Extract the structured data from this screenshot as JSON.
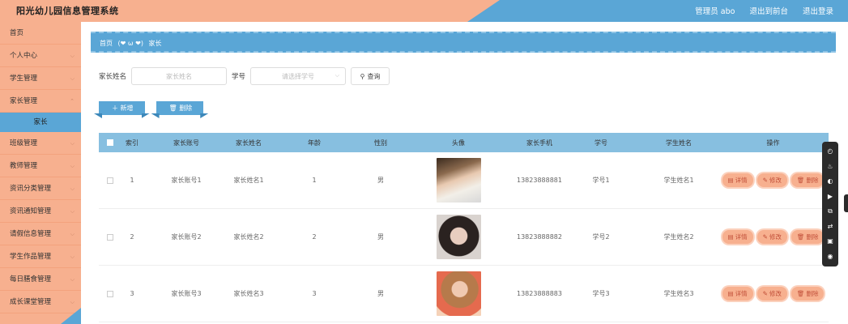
{
  "header": {
    "title": "阳光幼儿园信息管理系统",
    "nav": [
      "管理员 abo",
      "退出到前台",
      "退出登录"
    ]
  },
  "sidebar": {
    "items": [
      {
        "label": "首页",
        "chev": false
      },
      {
        "label": "个人中心",
        "chev": true
      },
      {
        "label": "学生管理",
        "chev": true
      },
      {
        "label": "家长管理",
        "chev": true
      },
      {
        "label": "班级管理",
        "chev": true
      },
      {
        "label": "教师管理",
        "chev": true
      },
      {
        "label": "资讯分类管理",
        "chev": true
      },
      {
        "label": "资讯通知管理",
        "chev": true
      },
      {
        "label": "请假信息管理",
        "chev": true
      },
      {
        "label": "学生作品管理",
        "chev": true
      },
      {
        "label": "每日膳食管理",
        "chev": true
      },
      {
        "label": "成长课堂管理",
        "chev": true
      }
    ],
    "sub_active": "家长"
  },
  "breadcrumb": {
    "home": "首页",
    "separator": "(❤ ω ❤)",
    "current": "家长"
  },
  "search": {
    "name_label": "家长姓名",
    "name_placeholder": "家长姓名",
    "sno_label": "学号",
    "sno_placeholder": "请选择学号",
    "query_label": "查询"
  },
  "actions": {
    "add_label": "新增",
    "delete_label": "删除"
  },
  "table": {
    "headers": [
      "索引",
      "家长账号",
      "家长姓名",
      "年龄",
      "性别",
      "头像",
      "家长手机",
      "学号",
      "学生姓名",
      "操作"
    ],
    "rows": [
      {
        "idx": "1",
        "account": "家长账号1",
        "name": "家长姓名1",
        "age": "1",
        "sex": "男",
        "phone": "13823888881",
        "sno": "学号1",
        "sname": "学生姓名1"
      },
      {
        "idx": "2",
        "account": "家长账号2",
        "name": "家长姓名2",
        "age": "2",
        "sex": "男",
        "phone": "13823888882",
        "sno": "学号2",
        "sname": "学生姓名2"
      },
      {
        "idx": "3",
        "account": "家长账号3",
        "name": "家长姓名3",
        "age": "3",
        "sex": "男",
        "phone": "13823888883",
        "sno": "学号3",
        "sname": "学生姓名3"
      }
    ],
    "ops": {
      "detail": "详情",
      "edit": "修改",
      "delete": "删除"
    }
  },
  "toolbar": {
    "icons": [
      "time-icon",
      "fire-icon",
      "palette-icon",
      "video-icon",
      "crop-icon",
      "swap-icon",
      "device-icon",
      "camera-icon"
    ]
  },
  "colors": {
    "peach": "#f7b08f",
    "blue": "#5aa6d6",
    "table_head": "#87bfe0"
  }
}
